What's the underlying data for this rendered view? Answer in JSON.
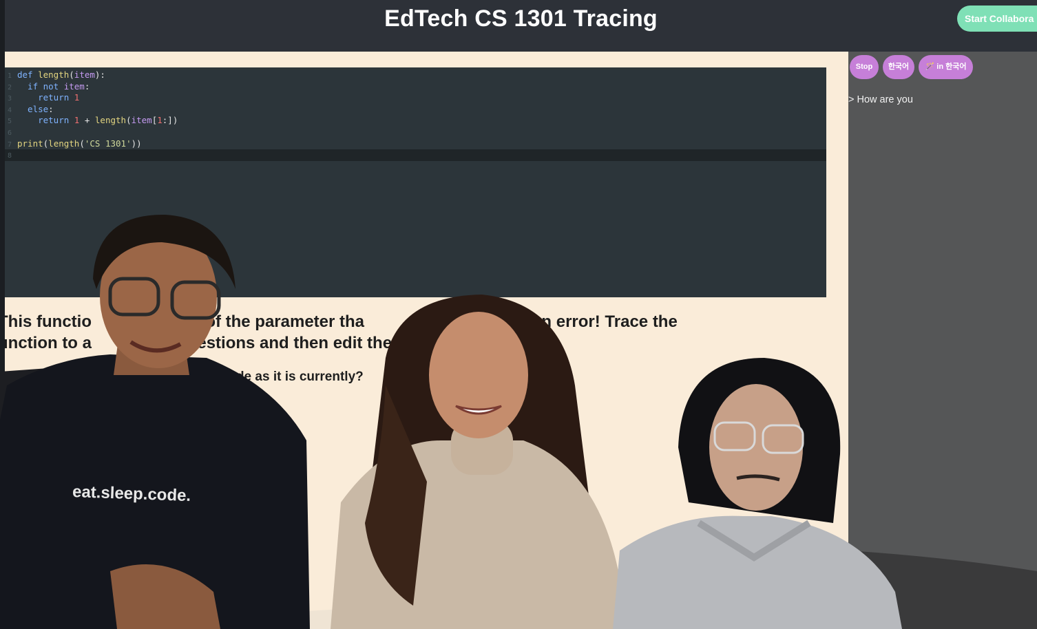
{
  "header": {
    "title": "EdTech CS 1301 Tracing",
    "collab_button": "Start Collabora"
  },
  "editor": {
    "line_numbers": [
      "1",
      "2",
      "3",
      "4",
      "5",
      "6",
      "7",
      "8"
    ],
    "lines": [
      [
        {
          "t": "def ",
          "c": "kw"
        },
        {
          "t": "length",
          "c": "fn"
        },
        {
          "t": "(",
          "c": "plain"
        },
        {
          "t": "item",
          "c": "var"
        },
        {
          "t": "):",
          "c": "plain"
        }
      ],
      [
        {
          "t": "  if not ",
          "c": "kw"
        },
        {
          "t": "item",
          "c": "var"
        },
        {
          "t": ":",
          "c": "plain"
        }
      ],
      [
        {
          "t": "    return ",
          "c": "kw"
        },
        {
          "t": "1",
          "c": "num"
        }
      ],
      [
        {
          "t": "  else",
          "c": "kw"
        },
        {
          "t": ":",
          "c": "plain"
        }
      ],
      [
        {
          "t": "    return ",
          "c": "kw"
        },
        {
          "t": "1",
          "c": "num"
        },
        {
          "t": " + ",
          "c": "plain"
        },
        {
          "t": "length",
          "c": "fn"
        },
        {
          "t": "(",
          "c": "plain"
        },
        {
          "t": "item",
          "c": "var"
        },
        {
          "t": "[",
          "c": "plain"
        },
        {
          "t": "1",
          "c": "num"
        },
        {
          "t": ":])",
          "c": "plain"
        }
      ],
      [],
      [
        {
          "t": "print",
          "c": "fn"
        },
        {
          "t": "(",
          "c": "plain"
        },
        {
          "t": "length",
          "c": "fn"
        },
        {
          "t": "(",
          "c": "plain"
        },
        {
          "t": "'CS 1301'",
          "c": "str"
        },
        {
          "t": "))",
          "c": "plain"
        }
      ],
      []
    ]
  },
  "prompt": {
    "line1": "This functio                ngth of the parameter tha           in, but there is an error! Trace the",
    "line2": "unction to a                       estions and then edit the",
    "question": "the code as it is currently?"
  },
  "sidebar": {
    "stop_label": "Stop",
    "lang_label": "한국어",
    "translate_label": "🪄 in 한국어",
    "chat_text": "> How are you"
  },
  "video": {
    "shirt_text": "eat.sleep.code."
  },
  "colors": {
    "accent_green": "#7fe0b6",
    "accent_purple": "#c67fd8",
    "topbar": "#2d3138",
    "page_bg": "#faecd9",
    "editor_bg": "#2c353a",
    "sidebar_bg": "#555657"
  }
}
